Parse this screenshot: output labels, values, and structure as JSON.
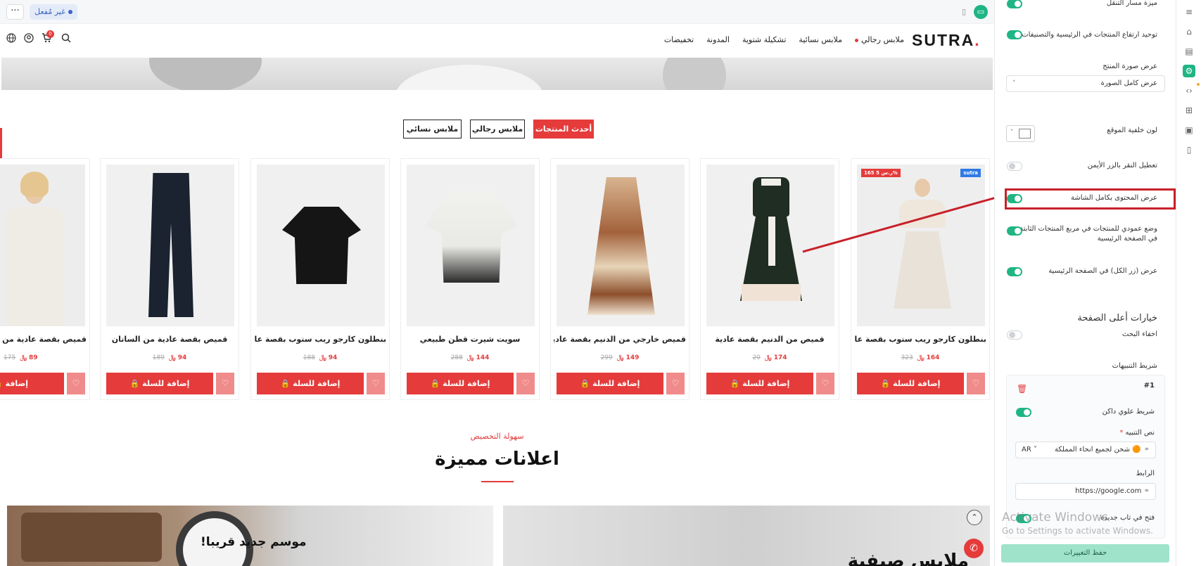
{
  "topbar": {
    "status": "غير مُفعل",
    "more": "···",
    "device_mobile_icon": "mobile-icon",
    "device_desktop_icon": "desktop-icon"
  },
  "nav": {
    "logo": "SUTRA",
    "logo_dot": ".",
    "links": [
      "ملابس رجالي",
      "ملابس نسائية",
      "تشكيلة شتوية",
      "المدونة",
      "تخفيضات"
    ],
    "cart_count": "0"
  },
  "tabs": [
    "أحدث المنتجات",
    "ملابس رجالي",
    "ملابس نسائي"
  ],
  "products": [
    {
      "name": "بنطلون كارجو ريب ستوب بقصة عادية",
      "price": "164",
      "old_price": "323",
      "sale_badge": "165 ر.س 5%",
      "new_badge": "sutra",
      "cta": "إضافة للسلة"
    },
    {
      "name": "قميص من الدنيم بقصة عادية",
      "price": "174",
      "old_price": "20",
      "cta": "إضافة للسلة"
    },
    {
      "name": "قميص خارجي من الدنيم بقصة عادية",
      "price": "149",
      "old_price": "299",
      "cta": "إضافة للسلة"
    },
    {
      "name": "سويت شيرت قطن طبيعي",
      "price": "144",
      "old_price": "288",
      "cta": "إضافة للسلة"
    },
    {
      "name": "بنطلون كارجو ريب ستوب بقصة عادية",
      "price": "94",
      "old_price": "188",
      "cta": "إضافة للسلة"
    },
    {
      "name": "قميص بقصة عادية من الساتان",
      "price": "94",
      "old_price": "189",
      "cta": "إضافة للسلة"
    },
    {
      "name": "قميص بقصة عادية من ا",
      "price": "89",
      "old_price": "175",
      "cta": "إضافة"
    }
  ],
  "currency_symbol": "﷼",
  "section": {
    "subtitle": "سهولة التخصيص",
    "title": "اعلانات مميزة"
  },
  "promos": {
    "left": "موسم جديد قريبا!",
    "right": "ملابس صيفية"
  },
  "panel": {
    "nav_bar_feature": "ميزة مسار التنقل",
    "unify_heights": "توحيد ارتفاع المنتجات في الرئيسية والتصنيفات",
    "image_display_label": "عرض صورة المنتج",
    "image_display_value": "عرض كامل الصورة",
    "site_bg_color": "لون خلفية الموقع",
    "disable_right_click": "تعطيل النقر بالزر الأيمن",
    "full_width": "عرض المحتوى بكامل الشاشة",
    "vertical_mode": "وضع عمودي للمنتجات في مربع المنتجات الثابتة في الصفحة الرئيسية",
    "show_all_button": "عرض (زر الكل) في الصفحة الرئيسية",
    "header_options": "خيارات أعلى الصفحة",
    "hide_search": "اخفاء البحث",
    "announcements_bar": "شريط التنبيهات",
    "item_number": "#1",
    "dark_top_bar": "شريط علوي داكن",
    "alert_text_label": "نص التنبيه",
    "alert_text_value": "شحن لجميع انحاء المملكة",
    "lang": "AR",
    "link_label": "الرابط",
    "link_value": "https://google.com",
    "new_tab": "فتح في تاب جديدة",
    "save": "حفظ التغييرات"
  },
  "watermark": {
    "line1": "Activate Windows",
    "line2": "Go to Settings to activate Windows."
  },
  "colors": {
    "accent": "#e53b3b",
    "toggle_on": "#1fb584",
    "callout": "#c8202a"
  }
}
